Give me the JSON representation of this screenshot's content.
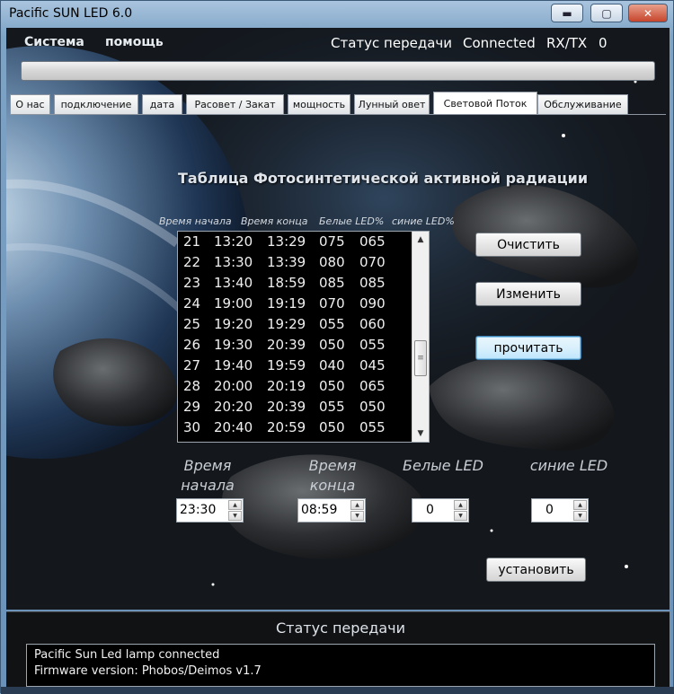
{
  "window": {
    "title": "Pacific SUN LED 6.0",
    "minimize": "▬",
    "maximize": "▢",
    "close": "✕"
  },
  "menu": {
    "system": "Система",
    "help": "помощь"
  },
  "top_status": {
    "label": "Статус передачи",
    "value": "Connected",
    "rxtx_label": "RX/TX",
    "rxtx_value": "0"
  },
  "tabs": [
    {
      "label": "О нас"
    },
    {
      "label": "подключение"
    },
    {
      "label": "дата"
    },
    {
      "label": "Расовет / Закат"
    },
    {
      "label": "мощность"
    },
    {
      "label": "Лунный овет"
    },
    {
      "label": "Световой Поток"
    },
    {
      "label": "Обслуживание"
    }
  ],
  "active_tab": "Световой Поток",
  "panel": {
    "title": "Таблица Фотосинтетической активной радиации",
    "columns": [
      "Время начала",
      "Время конца",
      "Белые LED%",
      "синие LED%"
    ],
    "rows": [
      [
        "21",
        "13:20",
        "13:29",
        "075",
        "065"
      ],
      [
        "22",
        "13:30",
        "13:39",
        "080",
        "070"
      ],
      [
        "23",
        "13:40",
        "18:59",
        "085",
        "085"
      ],
      [
        "24",
        "19:00",
        "19:19",
        "070",
        "090"
      ],
      [
        "25",
        "19:20",
        "19:29",
        "055",
        "060"
      ],
      [
        "26",
        "19:30",
        "20:39",
        "050",
        "055"
      ],
      [
        "27",
        "19:40",
        "19:59",
        "040",
        "045"
      ],
      [
        "28",
        "20:00",
        "20:19",
        "050",
        "065"
      ],
      [
        "29",
        "20:20",
        "20:39",
        "055",
        "050"
      ],
      [
        "30",
        "20:40",
        "20:59",
        "050",
        "055"
      ]
    ],
    "buttons": {
      "clear": "Очистить",
      "edit": "Изменить",
      "read": "прочитать",
      "set": "установить"
    },
    "fields": {
      "start_label_1": "Время",
      "start_label_2": "начала",
      "start_value": "23:30",
      "end_label_1": "Время",
      "end_label_2": "конца",
      "end_value": "08:59",
      "white_label": "Белые LED",
      "white_value": "0",
      "blue_label": "синие LED",
      "blue_value": "0"
    }
  },
  "status_panel": {
    "title": "Статус передачи",
    "lines": [
      "Pacific Sun Led lamp connected",
      "Firmware version: Phobos/Deimos v1.7"
    ]
  },
  "scroll": {
    "up": "▲",
    "down": "▼",
    "grip": "≡"
  },
  "spin": {
    "up": "▲",
    "down": "▼"
  },
  "colors": {
    "background": "#1b1f24",
    "text_light": "#dfe4ea",
    "listbox": "#000000"
  }
}
